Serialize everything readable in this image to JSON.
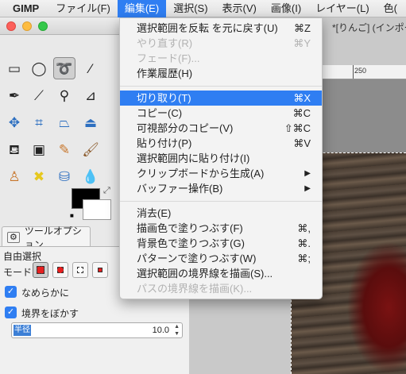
{
  "menubar": {
    "app": "GIMP",
    "items": [
      "ファイル(F)",
      "編集(E)",
      "選択(S)",
      "表示(V)",
      "画像(I)",
      "レイヤー(L)",
      "色("
    ],
    "active_index": 1
  },
  "edit_menu": {
    "items": [
      {
        "label": "選択範囲を反転 を元に戻す(U)",
        "shortcut": "⌘Z"
      },
      {
        "label": "やり直す(R)",
        "shortcut": "⌘Y",
        "disabled": true
      },
      {
        "label": "フェード(F)...",
        "disabled": true
      },
      {
        "label": "作業履歴(H)"
      },
      {
        "label": "切り取り(T)",
        "shortcut": "⌘X",
        "highlighted": true
      },
      {
        "label": "コピー(C)",
        "shortcut": "⌘C"
      },
      {
        "label": "可視部分のコピー(V)",
        "shortcut": "⇧⌘C"
      },
      {
        "label": "貼り付け(P)",
        "shortcut": "⌘V"
      },
      {
        "label": "選択範囲内に貼り付け(I)"
      },
      {
        "label": "クリップボードから生成(A)",
        "submenu": true
      },
      {
        "label": "バッファー操作(B)",
        "submenu": true
      },
      {
        "label": "消去(E)"
      },
      {
        "label": "描画色で塗りつぶす(F)",
        "shortcut": "⌘,"
      },
      {
        "label": "背景色で塗りつぶす(G)",
        "shortcut": "⌘."
      },
      {
        "label": "パターンで塗りつぶす(W)",
        "shortcut": "⌘;"
      },
      {
        "label": "選択範囲の境界線を描画(S)..."
      },
      {
        "label": "パスの境界線を描画(K)...",
        "disabled": true
      }
    ],
    "submenu_arrow": "▶"
  },
  "image_window": {
    "title": "*[りんご] (インポー",
    "ruler_label": "250"
  },
  "toolbox": {
    "tool_options_tab": "ツールオプション",
    "tool_name": "自由選択",
    "mode_label": "モード:",
    "antialias_label": "なめらかに",
    "antialias_checked": true,
    "feather_label": "境界をぼかす",
    "feather_checked": true,
    "radius_label": "半径",
    "radius_value": "10.0"
  },
  "colors": {
    "accent": "#2f7ef2",
    "foreground": "#000000",
    "background": "#ffffff"
  }
}
